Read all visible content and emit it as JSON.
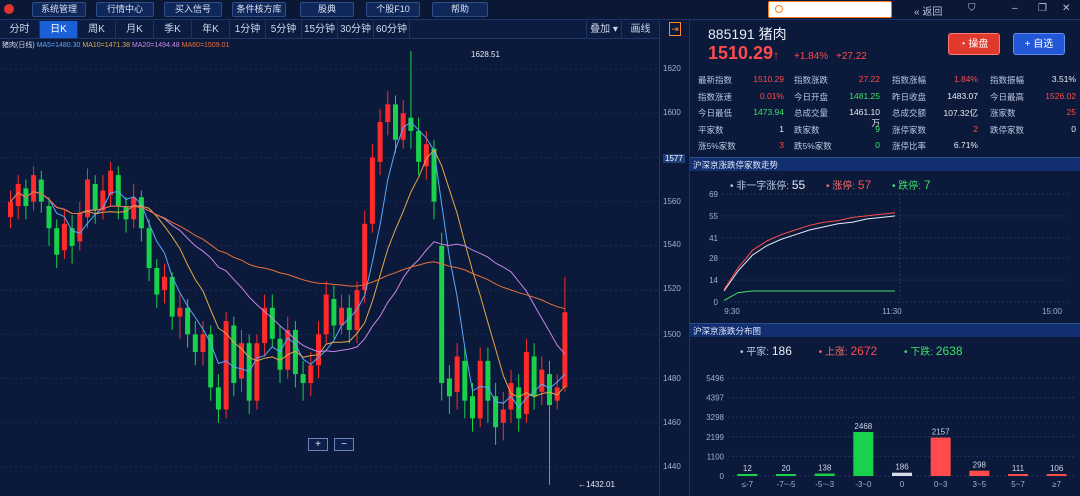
{
  "topbar": {
    "menus": [
      "系统管理",
      "行情中心",
      "买入信号",
      "条件核方库",
      "股典",
      "个股F10",
      "帮助"
    ],
    "back": "返回"
  },
  "period_tabs": [
    "分时",
    "日K",
    "周K",
    "月K",
    "季K",
    "年K",
    "1分钟",
    "5分钟",
    "15分钟",
    "30分钟",
    "60分钟"
  ],
  "active_tab": "日K",
  "toolbar_right": {
    "overlay": "叠加",
    "draw": "画线"
  },
  "ma_legend": {
    "label": "猪肉(日线)",
    "ma5": "MA5=1480.30",
    "ma10": "MA10=1471.38",
    "ma20": "MA20=1494.48",
    "ma60": "MA60=1509.01"
  },
  "colors": {
    "up": "#ff2b2b",
    "down": "#19d14a",
    "ma5": "#5aa7ff",
    "ma10": "#e0a84a",
    "ma20": "#c884e6",
    "ma60": "#e8703a"
  },
  "y_axis_labels": [
    "1620",
    "1600",
    "1580",
    "1560",
    "1540",
    "1520",
    "1500",
    "1480",
    "1460",
    "1440"
  ],
  "y_current": "1577",
  "annotations": {
    "high": "1628.51",
    "low": "1432.01"
  },
  "zoom": {
    "plus": "+",
    "minus": "−"
  },
  "stock": {
    "code": "885191",
    "name": "猪肉",
    "price": "1510.29",
    "arrow": "↑",
    "pct": "+1.84%",
    "chg": "+27.22",
    "btn_trade": "操盘",
    "btn_fav": "+ 自选"
  },
  "info": [
    [
      [
        "最新指数",
        "1510.29"
      ],
      [
        "指数涨跌",
        "27.22"
      ],
      [
        "指数涨幅",
        "1.84%"
      ],
      [
        "指数振幅",
        "3.51%"
      ]
    ],
    [
      [
        "指数涨速",
        "0.01%"
      ],
      [
        "今日开盘",
        "1481.25"
      ],
      [
        "昨日收盘",
        "1483.07"
      ],
      [
        "今日最高",
        "1526.02"
      ]
    ],
    [
      [
        "今日最低",
        "1473.94"
      ],
      [
        "总成交量",
        "1461.10万"
      ],
      [
        "总成交额",
        "107.32亿"
      ],
      [
        "涨家数",
        "25"
      ]
    ],
    [
      [
        "平家数",
        "1"
      ],
      [
        "跌家数",
        "9"
      ],
      [
        "涨停家数",
        "2"
      ],
      [
        "跌停家数",
        "0"
      ]
    ],
    [
      [
        "涨5%家数",
        "3"
      ],
      [
        "跌5%家数",
        "0"
      ],
      [
        "涨停比率",
        "6.71%"
      ],
      [
        "",
        ""
      ]
    ]
  ],
  "limit_section": {
    "title": "沪深京涨跌停家数走势",
    "legend": [
      [
        "非一字涨停:",
        "55"
      ],
      [
        "涨停:",
        "57"
      ],
      [
        "跌停:",
        "7"
      ]
    ],
    "y_labels": [
      "69",
      "55",
      "41",
      "28",
      "14",
      "0"
    ],
    "x_labels": [
      "9:30",
      "11:30",
      "15:00"
    ]
  },
  "dist_section": {
    "title": "沪深京涨跌分布图",
    "legend": [
      [
        "平家:",
        "186"
      ],
      [
        "上涨:",
        "2672"
      ],
      [
        "下跌:",
        "2638"
      ]
    ],
    "y_labels": [
      "5496",
      "4397",
      "3298",
      "2199",
      "1100",
      "0"
    ]
  },
  "chart_data": [
    {
      "type": "bar",
      "title": "沪深京涨跌分布图",
      "categories": [
        "≤-7",
        "-7~-5",
        "-5~-3",
        "-3~0",
        "0",
        "0~3",
        "3~5",
        "5~7",
        "≥7"
      ],
      "values": [
        12,
        20,
        138,
        2468,
        186,
        2157,
        298,
        111,
        106
      ],
      "ylim": [
        0,
        5496
      ]
    },
    {
      "type": "line",
      "title": "沪深京涨跌停家数走势",
      "series": [
        {
          "name": "非一字涨停",
          "values": [
            7,
            20,
            30,
            36,
            40,
            43,
            46,
            48,
            50,
            51,
            53,
            54,
            55
          ]
        },
        {
          "name": "涨停",
          "values": [
            8,
            22,
            33,
            39,
            43,
            46,
            49,
            51,
            52,
            54,
            55,
            56,
            57
          ]
        },
        {
          "name": "跌停",
          "values": [
            1,
            6,
            7,
            7,
            7,
            7,
            7,
            7,
            7,
            7,
            7,
            7,
            7
          ]
        }
      ],
      "ylim": [
        0,
        69
      ]
    }
  ]
}
